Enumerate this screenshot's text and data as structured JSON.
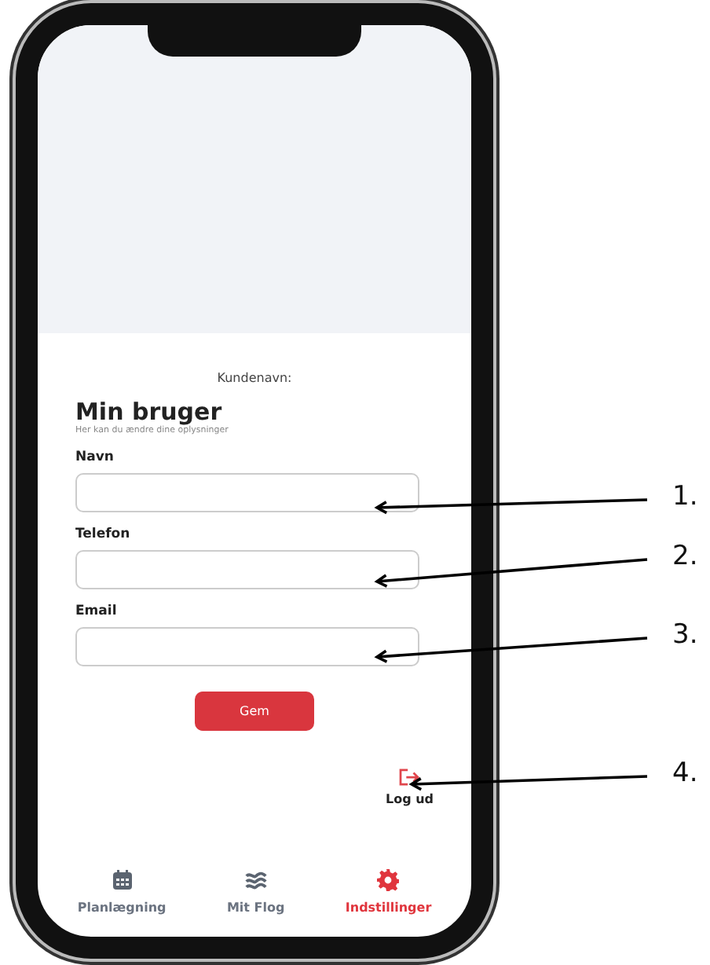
{
  "screen": {
    "customer_label": "Kundenavn:",
    "title": "Min bruger",
    "subtitle": "Her kan du ændre dine oplysninger",
    "fields": [
      {
        "label": "Navn"
      },
      {
        "label": "Telefon"
      },
      {
        "label": "Email"
      }
    ],
    "save_button": "Gem",
    "logout": "Log ud",
    "nav": [
      {
        "label": "Planlægning",
        "kind": "calendar",
        "selected": false
      },
      {
        "label": "Mit Flog",
        "kind": "waves",
        "selected": false
      },
      {
        "label": "Indstillinger",
        "kind": "gear",
        "selected": true
      }
    ]
  },
  "annotations": [
    {
      "label": "1."
    },
    {
      "label": "2."
    },
    {
      "label": "3."
    },
    {
      "label": "4."
    }
  ]
}
